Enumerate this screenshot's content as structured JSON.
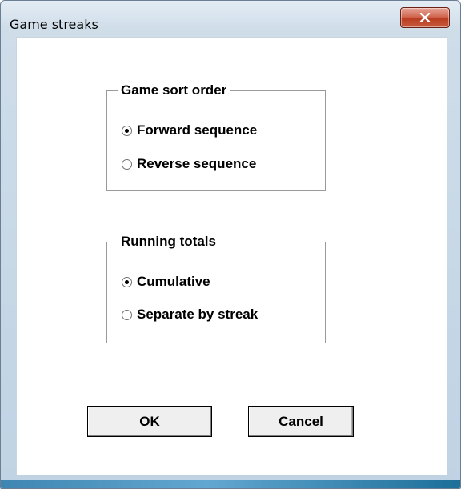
{
  "window": {
    "title": "Game streaks",
    "close_glyph": "X"
  },
  "sort_group": {
    "legend": "Game sort order",
    "options": [
      {
        "label": "Forward sequence",
        "selected": true
      },
      {
        "label": "Reverse sequence",
        "selected": false
      }
    ]
  },
  "totals_group": {
    "legend": "Running totals",
    "options": [
      {
        "label": "Cumulative",
        "selected": true
      },
      {
        "label": "Separate by streak",
        "selected": false
      }
    ]
  },
  "buttons": {
    "ok_label": "OK",
    "cancel_label": "Cancel"
  },
  "colors": {
    "close_button": "#c75a3c",
    "client_background": "#ffffff"
  }
}
